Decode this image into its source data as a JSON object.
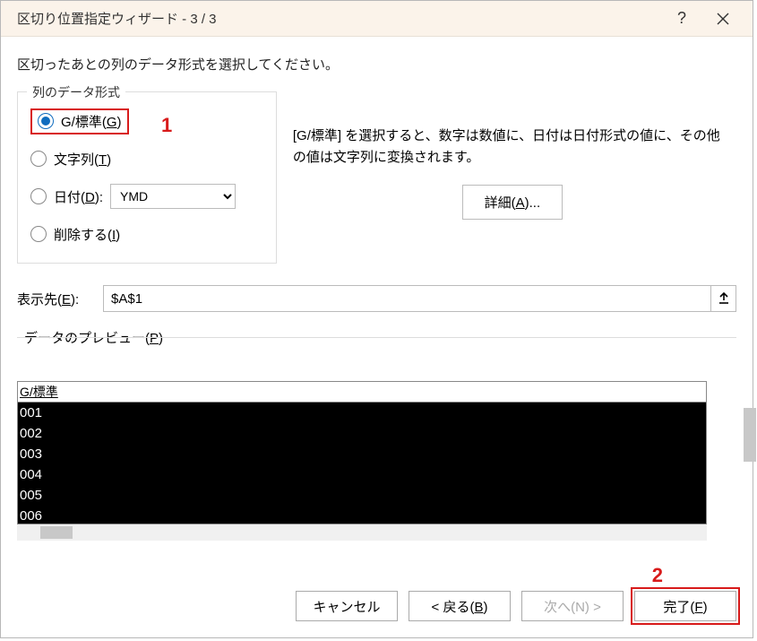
{
  "title": "区切り位置指定ウィザード - 3 / 3",
  "instruction": "区切ったあとの列のデータ形式を選択してください。",
  "fieldset": {
    "legend": "列のデータ形式",
    "options": {
      "general": {
        "prefix": "G/標準(",
        "mnemonic": "G",
        "suffix": ")"
      },
      "text": {
        "prefix": "文字列(",
        "mnemonic": "T",
        "suffix": ")"
      },
      "date": {
        "prefix": "日付(",
        "mnemonic": "D",
        "suffix": "):"
      },
      "skip": {
        "prefix": "削除する(",
        "mnemonic": "I",
        "suffix": ")"
      }
    },
    "date_format": "YMD"
  },
  "description": "[G/標準] を選択すると、数字は数値に、日付は日付形式の値に、その他の値は文字列に変換されます。",
  "detail_button": {
    "prefix": "詳細(",
    "mnemonic": "A",
    "suffix": ")..."
  },
  "destination": {
    "label": {
      "prefix": "表示先(",
      "mnemonic": "E",
      "suffix": "):"
    },
    "value": "$A$1"
  },
  "preview": {
    "label": {
      "prefix": "データのプレビュー(",
      "mnemonic": "P",
      "suffix": ")"
    },
    "header": "G/標準",
    "rows": [
      "001",
      "002",
      "003",
      "004",
      "005",
      "006"
    ]
  },
  "buttons": {
    "cancel": "キャンセル",
    "back": {
      "prefix": "< 戻る(",
      "mnemonic": "B",
      "suffix": ")"
    },
    "next": {
      "text": "次へ(N) >"
    },
    "finish": {
      "prefix": "完了(",
      "mnemonic": "F",
      "suffix": ")"
    }
  },
  "annotations": {
    "one": "1",
    "two": "2"
  }
}
